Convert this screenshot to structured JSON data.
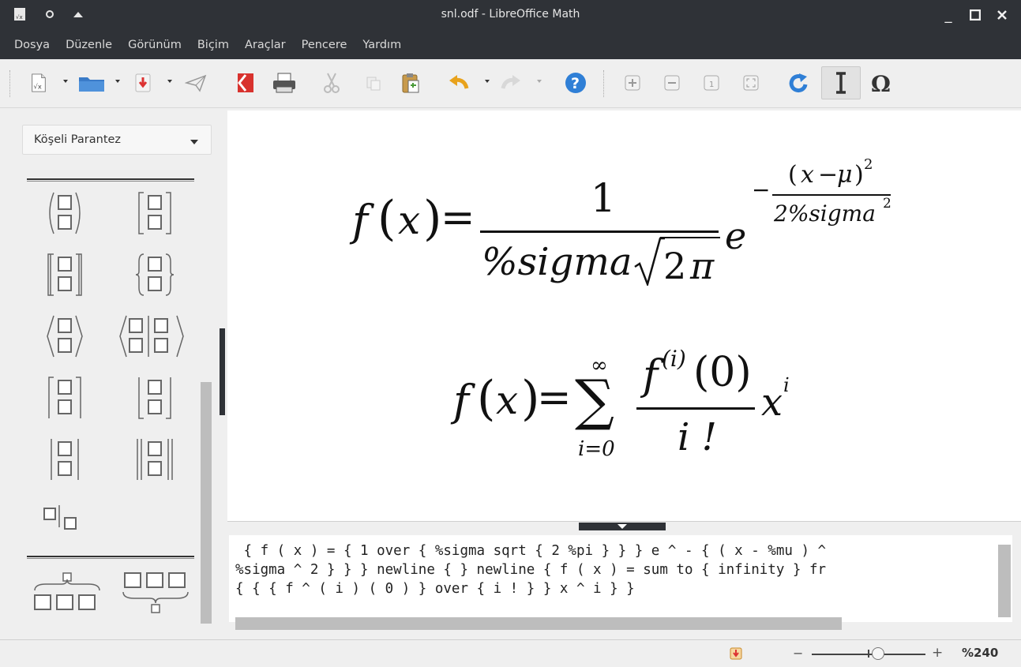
{
  "window": {
    "title": "snl.odf - LibreOffice Math",
    "controls": {
      "minimize": "_",
      "maximize": "□",
      "close": "✕"
    }
  },
  "menu": [
    "Dosya",
    "Düzenle",
    "Görünüm",
    "Biçim",
    "Araçlar",
    "Pencere",
    "Yardım"
  ],
  "toolbar": {
    "icons": [
      "new-formula-icon",
      "open-folder-icon",
      "save-icon",
      "send-icon",
      "export-pdf-icon",
      "print-icon",
      "cut-icon",
      "copy-icon",
      "paste-icon",
      "undo-icon",
      "redo-icon",
      "help-icon",
      "zoom-in-icon",
      "zoom-out-icon",
      "zoom-100-icon",
      "show-all-icon",
      "update-icon",
      "formula-cursor-icon",
      "symbols-icon"
    ]
  },
  "elements_panel": {
    "category": "Köşeli Parantez"
  },
  "formulas": {
    "f1_lhs": "f",
    "f1_x": "x",
    "f1_num": "1",
    "f1_den_sigma": "%sigma",
    "f1_den_two": "2",
    "f1_den_pi": "π",
    "f1_e": "e",
    "f1_minus": "−",
    "f1_exp_num_x": "x",
    "f1_exp_num_minus": "−",
    "f1_exp_num_mu": "μ",
    "f1_exp_num_pow": "2",
    "f1_exp_den": "2%sigma",
    "f1_exp_den_pow": "2",
    "f2_lhs": "f",
    "f2_x": "x",
    "f2_sum_sym": "∑",
    "f2_sum_top": "∞",
    "f2_sum_bottom": "i=0",
    "f2_num_f": "f",
    "f2_num_sup": "(i)",
    "f2_num_arg": "(0)",
    "f2_den": "i !",
    "f2_x_term": "x",
    "f2_x_pow": "i"
  },
  "editor": {
    "line1": " { f ( x ) = { 1 over { %sigma sqrt { 2 %pi } } } e ^ - { ( x - %mu ) ^",
    "line2": "%sigma ^ 2 } } } newline { } newline { f ( x ) = sum to { infinity } fr",
    "line3": "{ { { f ^ ( i ) ( 0 ) } over { i ! } } x ^ i } }"
  },
  "statusbar": {
    "zoom_minus": "−",
    "zoom_plus": "+",
    "zoom_value": "%240",
    "zoom_level_percent": 240
  }
}
